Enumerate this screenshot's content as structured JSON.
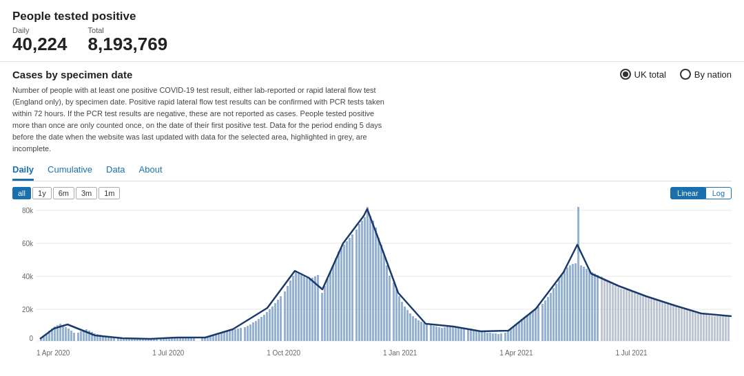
{
  "header": {
    "title": "People tested positive",
    "daily_label": "Daily",
    "total_label": "Total",
    "daily_value": "40,224",
    "total_value": "8,193,769"
  },
  "chart_section": {
    "title": "Cases by specimen date",
    "radio_uk": "UK total",
    "radio_nation": "By nation",
    "description": "Number of people with at least one positive COVID-19 test result, either lab-reported or rapid lateral flow test (England only), by specimen date. Positive rapid lateral flow test results can be confirmed with PCR tests taken within 72 hours. If the PCR test results are negative, these are not reported as cases. People tested positive more than once are only counted once, on the date of their first positive test. Data for the period ending 5 days before the date when the website was last updated with data for the selected area, highlighted in grey, are incomplete.",
    "tabs": [
      "Daily",
      "Cumulative",
      "Data",
      "About"
    ],
    "active_tab": "Daily",
    "time_buttons": [
      "all",
      "1y",
      "6m",
      "3m",
      "1m"
    ],
    "active_time": "all",
    "scale_buttons": [
      "Linear",
      "Log"
    ],
    "active_scale": "Linear",
    "x_labels": [
      "1 Apr 2020",
      "1 Jul 2020",
      "1 Oct 2020",
      "1 Jan 2021",
      "1 Apr 2021",
      "1 Jul 2021"
    ],
    "y_labels": [
      "80k",
      "60k",
      "40k",
      "20k",
      "0"
    ]
  }
}
